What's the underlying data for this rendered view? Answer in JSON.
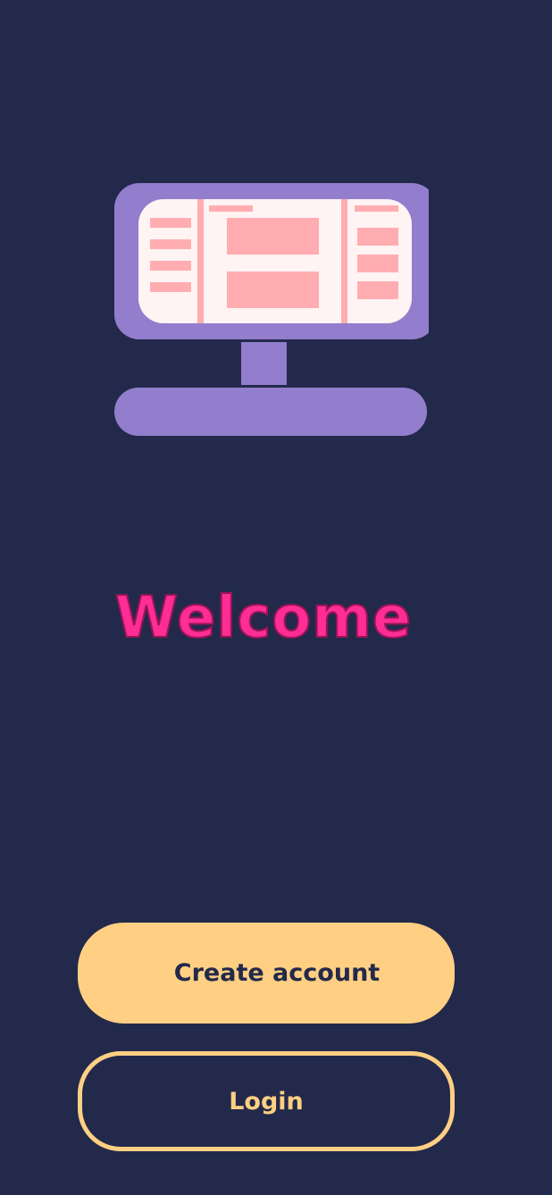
{
  "welcome": {
    "title": "Welcome"
  },
  "actions": {
    "create_account_label": "Create account",
    "login_label": "Login"
  },
  "illustration": {
    "icon": "computer-monitor-illustration"
  },
  "colors": {
    "background": "#23294a",
    "accent": "#ffd083",
    "title": "#ff2d95",
    "monitor": "#937dcd",
    "screen": "#fff3f3",
    "screen_blocks": "#ffadb1"
  }
}
